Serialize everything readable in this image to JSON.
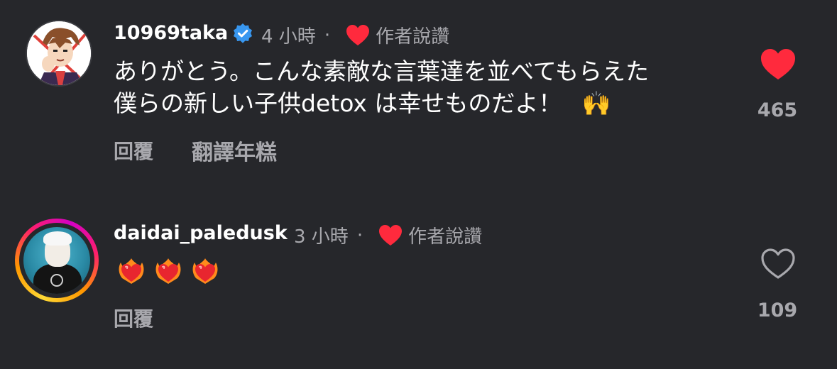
{
  "comments": [
    {
      "username": "10969taka",
      "verified": true,
      "time": "4 小時",
      "separator": "·",
      "author_liked": "作者說讚",
      "text_line1": "ありがとう。こんな素敵な言葉達を並べてもらえた",
      "text_line2": "僕らの新しい子供detox は幸せものだよ！",
      "text_emoji": "🙌",
      "reply_label": "回覆",
      "translate_label": "翻譯年糕",
      "like_count": "465",
      "liked": true
    },
    {
      "username": "daidai_paledusk",
      "verified": false,
      "time": "3 小時",
      "separator": "·",
      "author_liked": "作者說讚",
      "emojis": [
        "heart-on-fire",
        "heart-on-fire",
        "heart-on-fire"
      ],
      "reply_label": "回覆",
      "like_count": "109",
      "liked": false
    }
  ],
  "colors": {
    "background": "#26272b",
    "like_red": "#ff2a3d",
    "verified_blue": "#3897f0",
    "muted_text": "#a8a8ad"
  },
  "icons": {
    "verified": "verified-badge-icon",
    "author_heart": "heart-filled-icon",
    "like_filled": "heart-filled-icon",
    "like_outline": "heart-outline-icon"
  }
}
